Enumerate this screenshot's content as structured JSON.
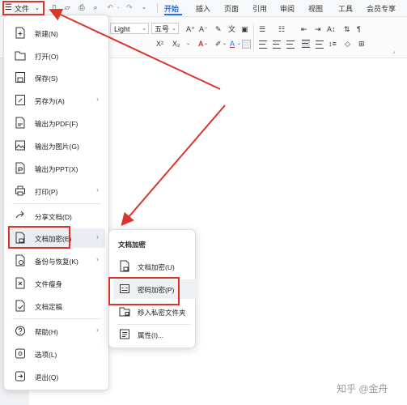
{
  "toolbar": {
    "file_menu_label": "文件",
    "tabs": [
      "开始",
      "插入",
      "页面",
      "引用",
      "审阅",
      "视图",
      "工具",
      "会员专享"
    ],
    "active_tab": "开始"
  },
  "ribbon": {
    "font_name": "Light",
    "font_size": "五号"
  },
  "file_menu": {
    "items": [
      {
        "label": "新建(N)",
        "icon": "new-doc-icon",
        "arrow": true
      },
      {
        "label": "打开(O)",
        "icon": "folder-open-icon",
        "arrow": false
      },
      {
        "label": "保存(S)",
        "icon": "save-icon",
        "arrow": false
      },
      {
        "label": "另存为(A)",
        "icon": "save-as-icon",
        "arrow": true
      },
      {
        "label": "输出为PDF(F)",
        "icon": "pdf-export-icon",
        "arrow": false
      },
      {
        "label": "输出为图片(G)",
        "icon": "image-export-icon",
        "arrow": false
      },
      {
        "label": "输出为PPT(X)",
        "icon": "ppt-export-icon",
        "arrow": false
      },
      {
        "label": "打印(P)",
        "icon": "print-icon",
        "arrow": true
      },
      {
        "label": "分享文档(D)",
        "icon": "share-icon",
        "arrow": false
      },
      {
        "label": "文档加密(E)",
        "icon": "doc-encrypt-icon",
        "arrow": true
      },
      {
        "label": "备份与恢复(K)",
        "icon": "backup-icon",
        "arrow": true
      },
      {
        "label": "文件瘦身",
        "icon": "slim-file-icon",
        "arrow": false
      },
      {
        "label": "文档定稿",
        "icon": "finalize-icon",
        "arrow": false
      },
      {
        "label": "帮助(H)",
        "icon": "help-icon",
        "arrow": true
      },
      {
        "label": "选项(L)",
        "icon": "options-icon",
        "arrow": false
      },
      {
        "label": "退出(Q)",
        "icon": "exit-icon",
        "arrow": false
      }
    ]
  },
  "encrypt_submenu": {
    "title": "文档加密",
    "items": [
      {
        "label": "文档加密(U)",
        "icon": "doc-lock-icon"
      },
      {
        "label": "密码加密(P)",
        "icon": "password-icon"
      },
      {
        "label": "移入私密文件夹",
        "icon": "private-folder-icon"
      },
      {
        "label": "属性(I)...",
        "icon": "properties-icon"
      }
    ]
  },
  "watermark": "知乎 @金舟",
  "colors": {
    "accent": "#1f6feb",
    "annotation_red": "#d9352b"
  }
}
